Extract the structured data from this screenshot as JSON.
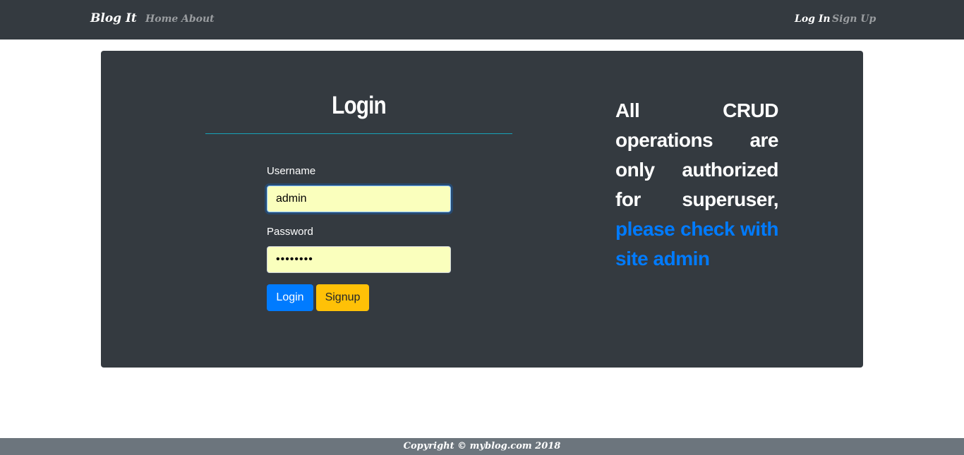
{
  "navbar": {
    "brand": "Blog It",
    "links": [
      {
        "label": "Home"
      },
      {
        "label": "About"
      }
    ],
    "right_links": [
      {
        "label": "Log In",
        "active": true
      },
      {
        "label": "Sign Up",
        "active": false
      }
    ]
  },
  "login": {
    "title": "Login",
    "username_label": "Username",
    "username_value": "admin",
    "password_label": "Password",
    "password_value": "••••••••",
    "login_button": "Login",
    "signup_button": "Signup"
  },
  "notice": {
    "text": "All CRUD operations are only authorized for superuser,",
    "highlight": "please check with site admin"
  },
  "footer": {
    "text": "Copyright © myblog.com 2018"
  },
  "colors": {
    "navbar_bg": "#343a40",
    "card_bg": "#343a40",
    "primary": "#007bff",
    "warning": "#ffc107",
    "footer_bg": "#6c757d",
    "autofill_bg": "#faffbd"
  }
}
